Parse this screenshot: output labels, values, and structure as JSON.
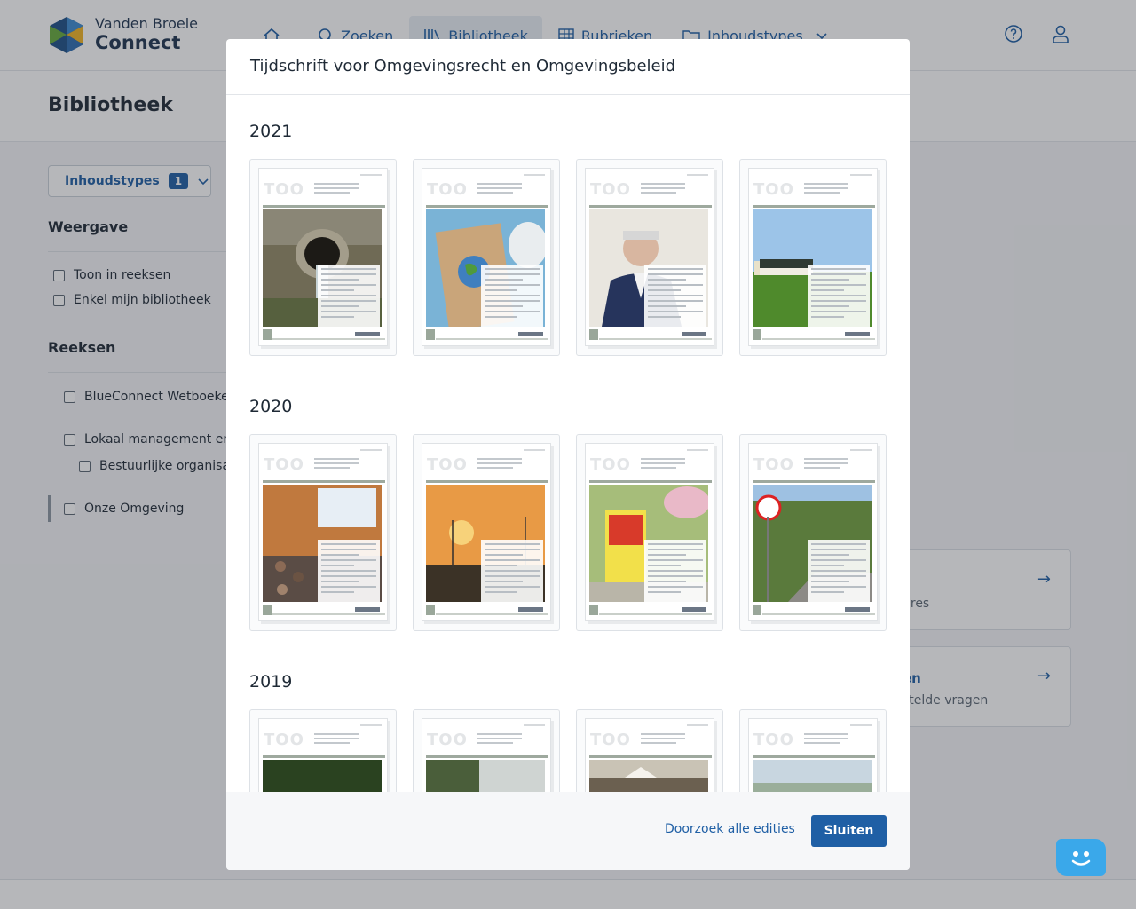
{
  "brand": {
    "line1": "Vanden Broele",
    "line2": "Connect"
  },
  "nav": {
    "items": [
      {
        "label": "",
        "icon": "home-icon"
      },
      {
        "label": "Zoeken",
        "icon": "search-icon"
      },
      {
        "label": "Bibliotheek",
        "icon": "library-icon",
        "active": true
      },
      {
        "label": "Rubrieken",
        "icon": "grid-icon"
      },
      {
        "label": "Inhoudstypes",
        "icon": "folder-icon"
      }
    ]
  },
  "page": {
    "title": "Bibliotheek"
  },
  "sidebar": {
    "filter": {
      "label": "Inhoudstypes",
      "count": "1"
    },
    "weergave": {
      "title": "Weergave",
      "options": [
        "Toon in reeksen",
        "Enkel mijn bibliotheek"
      ]
    },
    "reeksen": {
      "title": "Reeksen",
      "items": [
        "BlueConnect Wetboeken",
        "Lokaal management en b",
        "Bestuurlijke organisati",
        "Onze Omgeving"
      ]
    }
  },
  "cards": {
    "card1": {
      "sub": "ures"
    },
    "card2": {
      "title": "en",
      "sub": "stelde vragen"
    }
  },
  "modal": {
    "title": "Tijdschrift voor Omgevingsrecht en Omgevingsbeleid",
    "years": [
      "2021",
      "2020",
      "2019"
    ],
    "cover_photos": {
      "2021": [
        "drain-pipe",
        "climate-sign",
        "portrait",
        "farm-field"
      ],
      "2020": [
        "lecture-hall",
        "sunset-windmills",
        "road-sign-barrier",
        "speed-sign"
      ],
      "2019": [
        "forest",
        "trees-sky",
        "farmhouse",
        "landscape"
      ]
    },
    "search_all_label": "Doorzoek alle edities",
    "close_label": "Sluiten"
  },
  "colors": {
    "primary": "#1f5fa5",
    "chat": "#3aa8ea"
  }
}
